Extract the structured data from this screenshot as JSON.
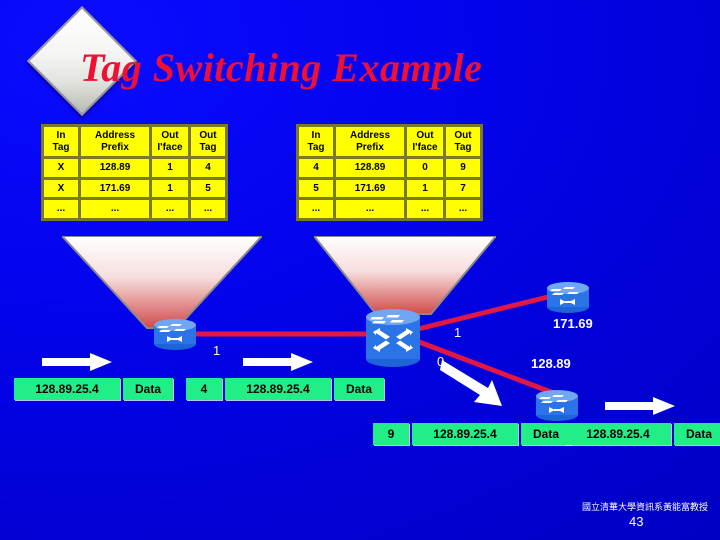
{
  "slide": {
    "title": "Tag Switching Example",
    "background_color": "#0000ff",
    "title_color": "#ee1133",
    "page_number": "43",
    "footer_credit": "國立清華大學資訊系黃能富教授"
  },
  "tables": {
    "headers": [
      "In Tag",
      "Address Prefix",
      "Out I'face",
      "Out Tag"
    ],
    "headers_split": [
      {
        "line1": "In",
        "line2": "Tag"
      },
      {
        "line1": "Address",
        "line2": "Prefix"
      },
      {
        "line1": "Out",
        "line2": "I'face"
      },
      {
        "line1": "Out",
        "line2": "Tag"
      }
    ],
    "left": {
      "name": "left-tag-table",
      "rows": [
        {
          "in_tag": "X",
          "prefix": "128.89",
          "out_iface": "1",
          "out_tag": "4"
        },
        {
          "in_tag": "X",
          "prefix": "171.69",
          "out_iface": "1",
          "out_tag": "5"
        },
        {
          "in_tag": "...",
          "prefix": "...",
          "out_iface": "...",
          "out_tag": "..."
        }
      ]
    },
    "right": {
      "name": "right-tag-table",
      "rows": [
        {
          "in_tag": "4",
          "prefix": "128.89",
          "out_iface": "0",
          "out_tag": "9"
        },
        {
          "in_tag": "5",
          "prefix": "171.69",
          "out_iface": "1",
          "out_tag": "7"
        },
        {
          "line3": true,
          "in_tag": "...",
          "prefix": "...",
          "out_iface": "...",
          "out_tag": "..."
        }
      ]
    }
  },
  "topology": {
    "routers": [
      {
        "id": "router-left",
        "label": ""
      },
      {
        "id": "router-core",
        "label": ""
      },
      {
        "id": "router-171",
        "label": "171.69"
      },
      {
        "id": "router-128",
        "label": "128.89"
      },
      {
        "id": "router-edge",
        "label": ""
      }
    ],
    "interface_labels": [
      {
        "id": "iface-left-1",
        "text": "1"
      },
      {
        "id": "iface-core-1",
        "text": "1"
      },
      {
        "id": "iface-core-0",
        "text": "0"
      }
    ],
    "network_labels": [
      {
        "id": "net-171",
        "text": "171.69"
      },
      {
        "id": "net-128",
        "text": "128.89"
      }
    ],
    "link_color": "#e11744"
  },
  "packets": [
    {
      "id": "packet-1",
      "fields": [
        {
          "kind": "addr",
          "text": "128.89.25.4"
        },
        {
          "kind": "data",
          "text": "Data"
        }
      ]
    },
    {
      "id": "packet-2",
      "fields": [
        {
          "kind": "tag",
          "text": "4"
        },
        {
          "kind": "addr",
          "text": "128.89.25.4"
        },
        {
          "kind": "data",
          "text": "Data"
        }
      ]
    },
    {
      "id": "packet-3",
      "fields": [
        {
          "kind": "tag",
          "text": "9"
        },
        {
          "kind": "addr",
          "text": "128.89.25.4"
        },
        {
          "kind": "data",
          "text": "Data"
        }
      ]
    },
    {
      "id": "packet-4",
      "fields": [
        {
          "kind": "addr",
          "text": "128.89.25.4"
        },
        {
          "kind": "data",
          "text": "Data"
        }
      ]
    }
  ]
}
